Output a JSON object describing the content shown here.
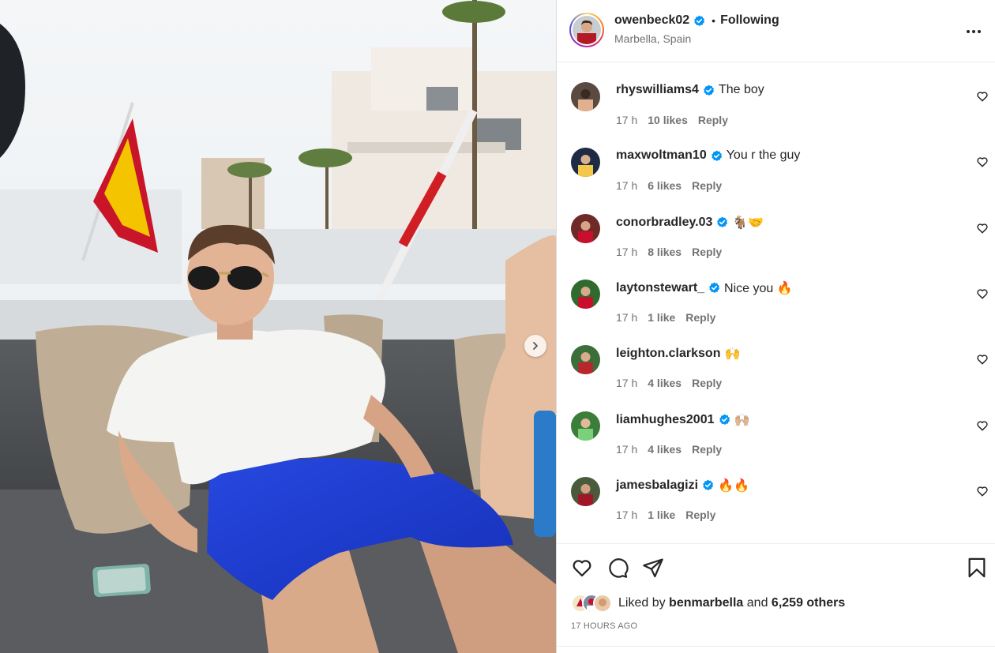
{
  "post": {
    "owner": {
      "username": "owenbeck02",
      "verified": true,
      "follow_state": "Following",
      "separator": "•",
      "location": "Marbella, Spain"
    },
    "more_icon": "more-horizontal-icon",
    "photo_alt": "photo",
    "next_icon": "chevron-right-icon"
  },
  "comments": [
    {
      "username": "rhyswilliams4",
      "verified": true,
      "text": "The boy",
      "time": "17 h",
      "likes": "10 likes",
      "reply": "Reply"
    },
    {
      "username": "maxwoltman10",
      "verified": true,
      "text": "You r the guy",
      "time": "17 h",
      "likes": "6 likes",
      "reply": "Reply"
    },
    {
      "username": "conorbradley.03",
      "verified": true,
      "text": "🐐🤝",
      "time": "17 h",
      "likes": "8 likes",
      "reply": "Reply"
    },
    {
      "username": "laytonstewart_",
      "verified": true,
      "text": "Nice you 🔥",
      "time": "17 h",
      "likes": "1 like",
      "reply": "Reply"
    },
    {
      "username": "leighton.clarkson",
      "verified": false,
      "text": "🙌",
      "time": "17 h",
      "likes": "4 likes",
      "reply": "Reply"
    },
    {
      "username": "liamhughes2001",
      "verified": true,
      "text": "🙌🏼",
      "time": "17 h",
      "likes": "4 likes",
      "reply": "Reply"
    },
    {
      "username": "jamesbalagizi",
      "verified": true,
      "text": "🔥🔥",
      "time": "17 h",
      "likes": "1 like",
      "reply": "Reply"
    }
  ],
  "actions": {
    "like_icon": "heart-icon",
    "comment_icon": "comment-icon",
    "share_icon": "send-icon",
    "save_icon": "bookmark-icon"
  },
  "likes_summary": {
    "prefix": "Liked by",
    "liker": "benmarbella",
    "connector": "and",
    "others": "6,259 others"
  },
  "timestamp": "17 HOURS AGO",
  "colors": {
    "verified": "#0095f6",
    "secondary_text": "#737373",
    "primary_text": "#262626",
    "shorts_blue": "#1f3fd6"
  }
}
